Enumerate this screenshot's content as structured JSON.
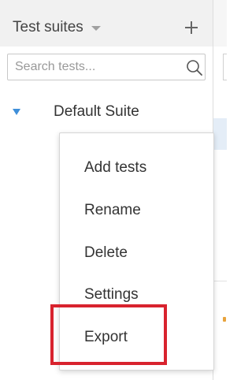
{
  "sidebar": {
    "title": "Test suites",
    "title_dropdown_icon": "caret-down-icon",
    "add_icon": "plus-icon",
    "search": {
      "placeholder": "Search tests...",
      "value": "",
      "icon": "search-icon"
    },
    "tree": {
      "items": [
        {
          "label": "Default Suite",
          "expanded": true,
          "icon": "triangle-down-icon"
        }
      ]
    }
  },
  "context_menu": {
    "items": [
      {
        "label": "Add tests"
      },
      {
        "label": "Rename"
      },
      {
        "label": "Delete"
      },
      {
        "label": "Settings"
      },
      {
        "label": "Export"
      }
    ],
    "highlighted_item": "Export"
  },
  "colors": {
    "header_bg": "#f1f1f1",
    "accent_blue": "#3f8fd9",
    "highlight_red": "#d8232e",
    "selection_bg": "#e4edf7",
    "indicator_orange": "#e8a33c"
  }
}
